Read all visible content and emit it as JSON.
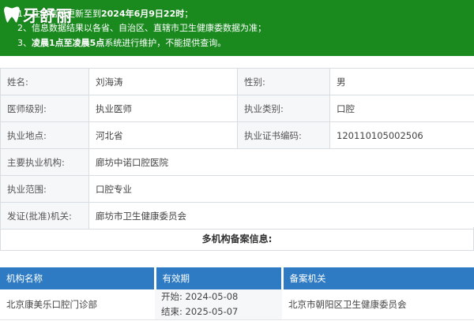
{
  "notice": {
    "line1_a": "1、",
    "line1_b": "注册信息更新至到",
    "line1_c": "2024年6月9日22时",
    "line1_d": "；",
    "line2": "2、信息数据结果以各省、自治区、直辖市卫生健康委数据为准；",
    "line3_a": "3、",
    "line3_b": "凌晨1点至凌晨5点",
    "line3_c": "系统进行维护，不能提供查询。",
    "logo_text": "牙舒丽"
  },
  "info": {
    "rows": [
      {
        "label1": "姓名:",
        "value1": "刘海涛",
        "label2": "性别:",
        "value2": "男"
      },
      {
        "label1": "医师级别:",
        "value1": "执业医师",
        "label2": "执业类别:",
        "value2": "口腔"
      },
      {
        "label1": "执业地点:",
        "value1": "河北省",
        "label2": "执业证书编码:",
        "value2": "120110105002506"
      }
    ],
    "org_label": "主要执业机构:",
    "org_value": "廊坊中诺口腔医院",
    "scope_label": "执业范围:",
    "scope_value": "口腔专业",
    "issuer_label": "发证(批准)机关:",
    "issuer_value": "廊坊市卫生健康委员会"
  },
  "multi": {
    "title": "多机构备案信息:",
    "headers": [
      "机构名称",
      "有效期",
      "备案机关"
    ],
    "rows": [
      {
        "org": "北京康美乐口腔门诊部",
        "start_label": "开始:",
        "start": "2024-05-08",
        "end_label": "结束:",
        "end": "2025-05-07",
        "authority": "北京市朝阳区卫生健康委员会"
      }
    ]
  },
  "colors": {
    "notice_bg": "#1a8a1f",
    "header_bg": "#2e7bc4",
    "label_bg": "#f6f7f9"
  }
}
